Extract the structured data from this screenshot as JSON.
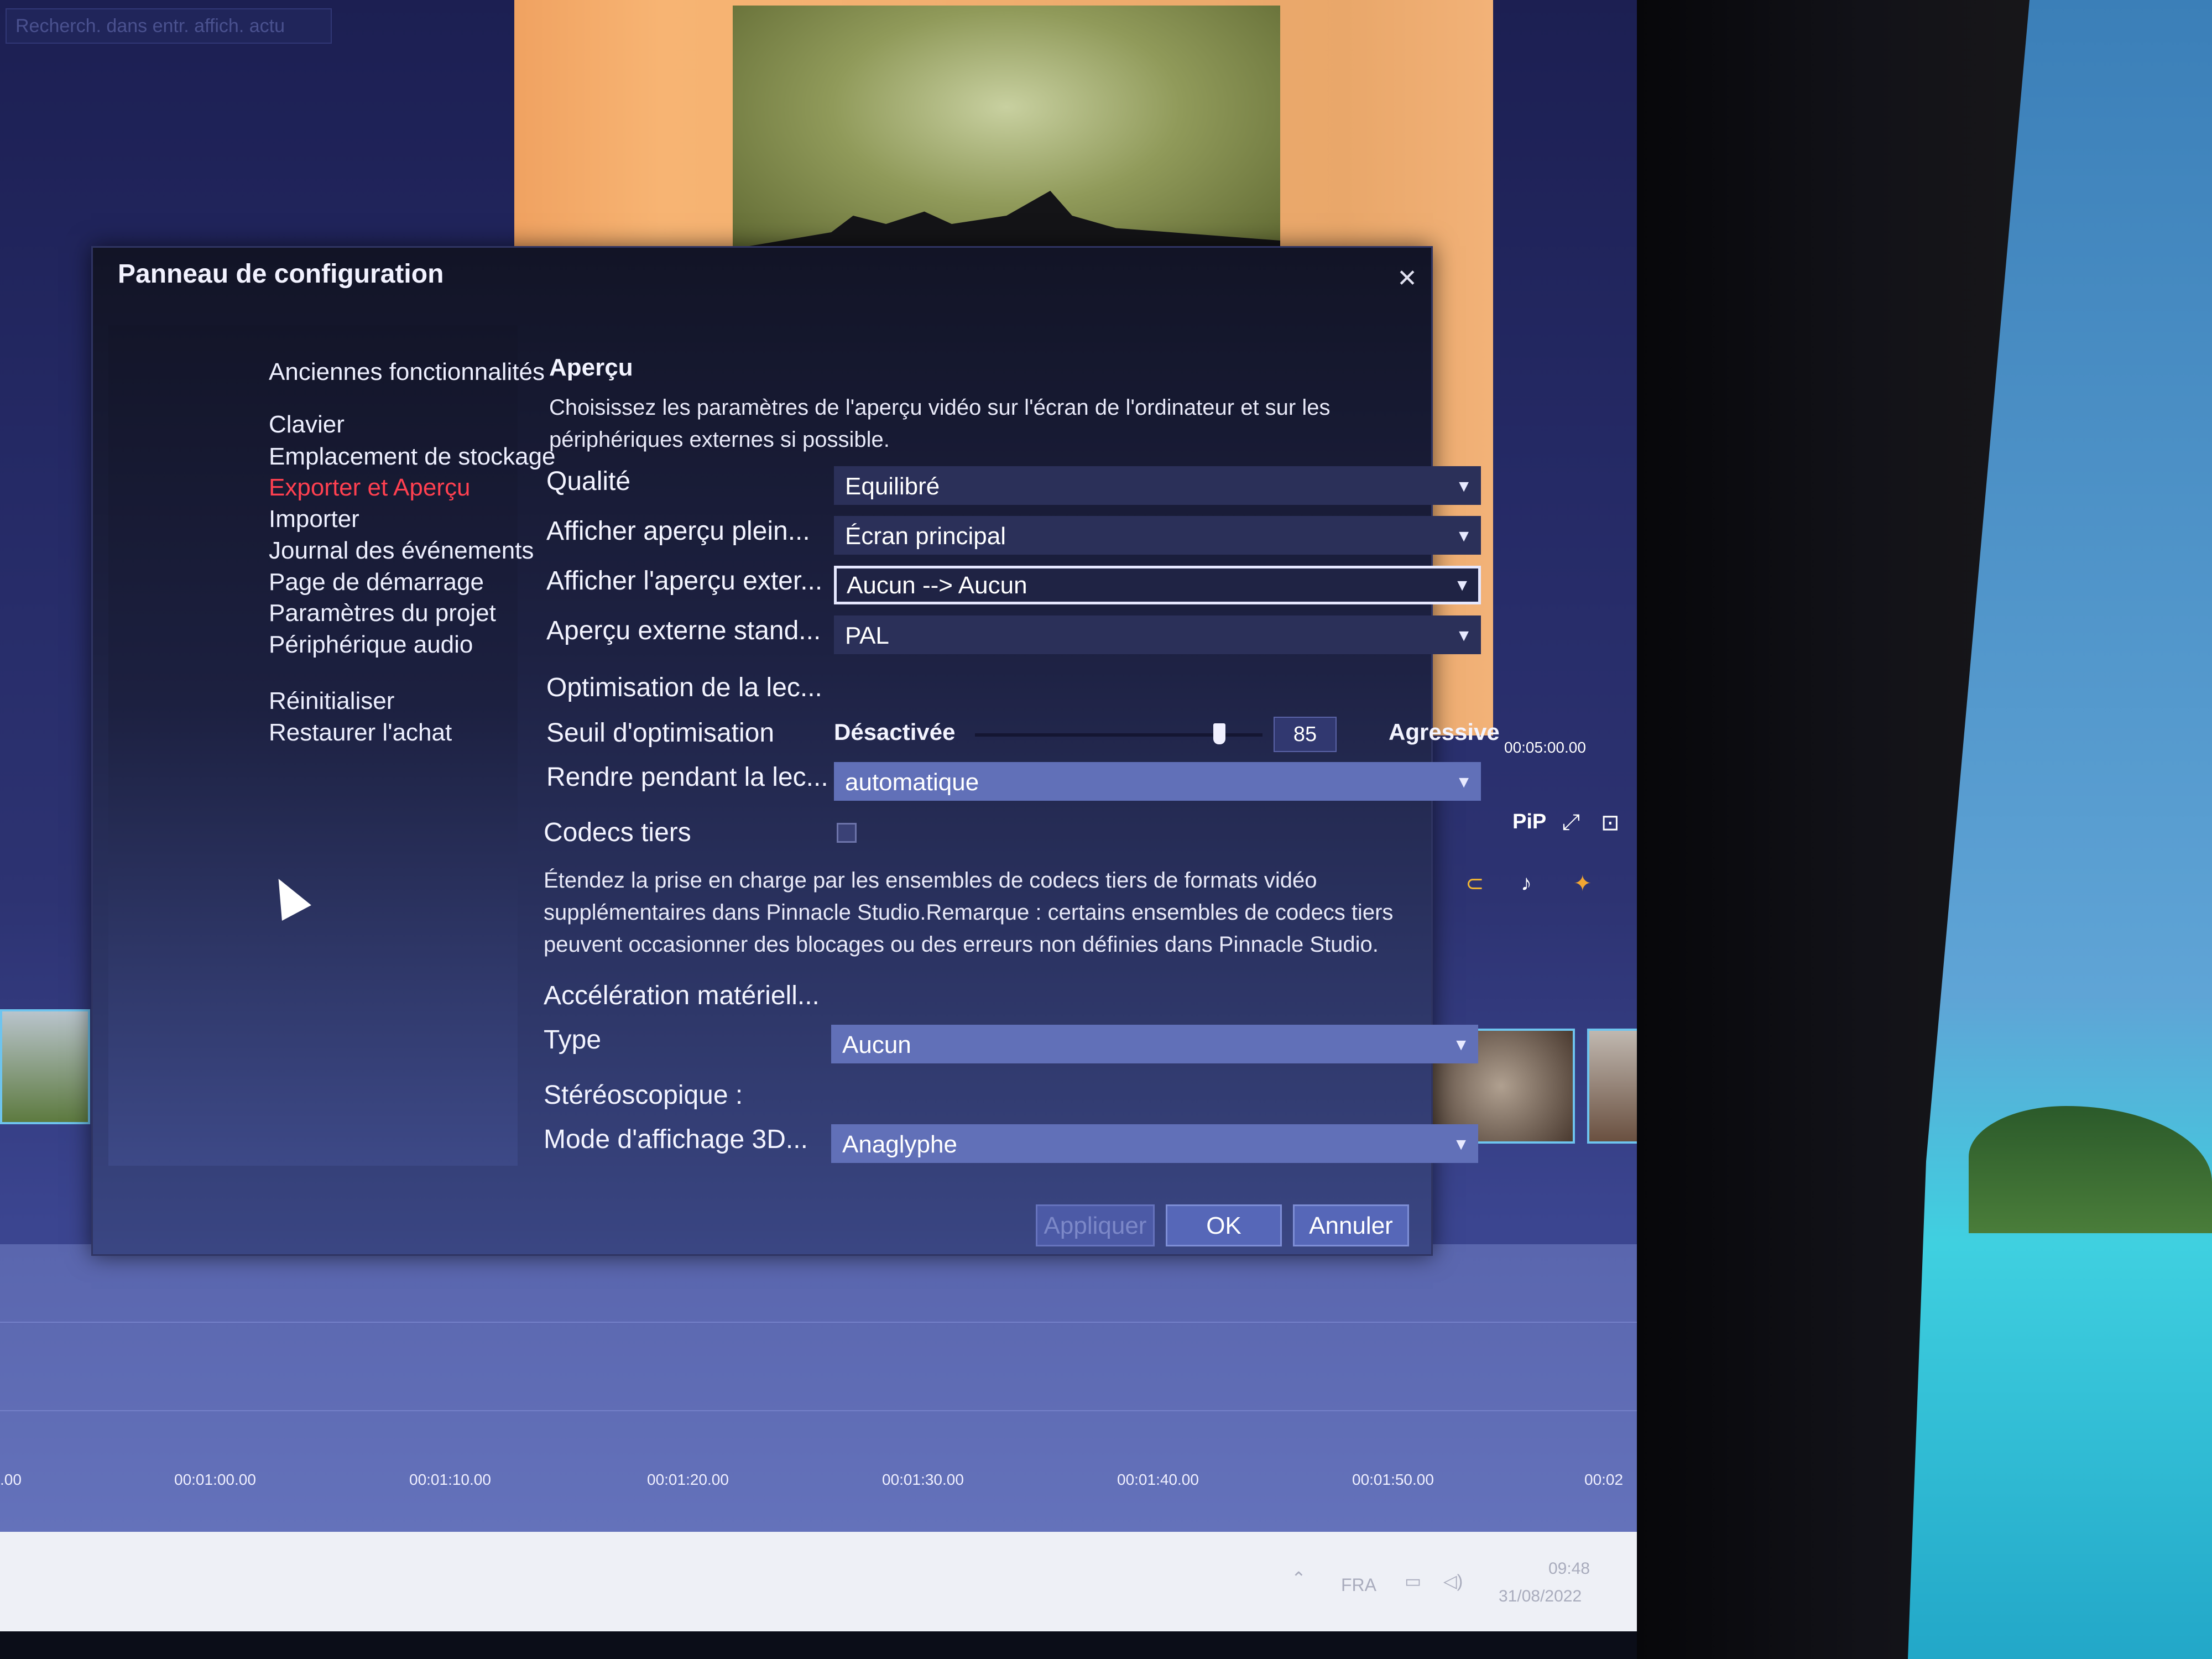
{
  "background": {
    "search_placeholder": "Recherch. dans entr. affich. actu",
    "timecode": "00:05:00.00",
    "pip_label": "PiP",
    "timeline_ticks": [
      "00:01:00.00",
      "00:01:10.00",
      "00:01:20.00",
      "00:01:30.00",
      "00:01:40.00",
      "00:01:50.00",
      "00:02"
    ],
    "timeline_tick_left_partial": ".00",
    "taskbar": {
      "lang": "FRA",
      "time": "09:48",
      "date": "31/08/2022"
    }
  },
  "dialog": {
    "title": "Panneau de configuration",
    "close_glyph": "✕",
    "sidebar": [
      {
        "label": "Anciennes fonctionnalités"
      },
      {
        "label": "Clavier"
      },
      {
        "label": "Emplacement de stockage"
      },
      {
        "label": "Exporter et Aperçu",
        "active": true
      },
      {
        "label": "Importer"
      },
      {
        "label": "Journal des événements"
      },
      {
        "label": "Page de démarrage"
      },
      {
        "label": "Paramètres du projet"
      },
      {
        "label": "Périphérique audio"
      },
      {
        "label": "Réinitialiser"
      },
      {
        "label": "Restaurer l'achat"
      }
    ],
    "section_title": "Aperçu",
    "description": "Choisissez les paramètres de l'aperçu vidéo sur l'écran de l'ordinateur et sur les périphériques externes si possible.",
    "fields": {
      "qualite": {
        "label": "Qualité",
        "value": "Equilibré"
      },
      "afficher_plein": {
        "label": "Afficher aperçu plein...",
        "value": "Écran principal"
      },
      "afficher_exter": {
        "label": "Afficher l'aperçu exter...",
        "value": "Aucun --> Aucun"
      },
      "apercu_externe": {
        "label": "Aperçu externe stand...",
        "value": "PAL"
      }
    },
    "optimisation_title": "Optimisation de la lec...",
    "seuil": {
      "label": "Seuil d'optimisation",
      "min_label": "Désactivée",
      "max_label": "Agressive",
      "value": "85",
      "fraction": 0.85
    },
    "rendre": {
      "label": "Rendre pendant la lec...",
      "value": "automatique"
    },
    "codecs": {
      "label": "Codecs tiers",
      "checked": false,
      "description": "Étendez la prise en charge par les ensembles de codecs tiers de formats vidéo supplémentaires dans Pinnacle Studio.Remarque : certains ensembles de codecs tiers peuvent occasionner des blocages ou des erreurs non définies dans Pinnacle Studio."
    },
    "acceleration_title": "Accélération matériell...",
    "type": {
      "label": "Type",
      "value": "Aucun"
    },
    "stereo_title": "Stéréoscopique :",
    "mode3d": {
      "label": "Mode d'affichage 3D...",
      "value": "Anaglyphe"
    },
    "buttons": {
      "apply": "Appliquer",
      "ok": "OK",
      "cancel": "Annuler"
    },
    "caret": "▼"
  },
  "colors": {
    "active_item": "#ff4050",
    "dialog_bg": "#1d2142",
    "button": "#5667b8"
  }
}
